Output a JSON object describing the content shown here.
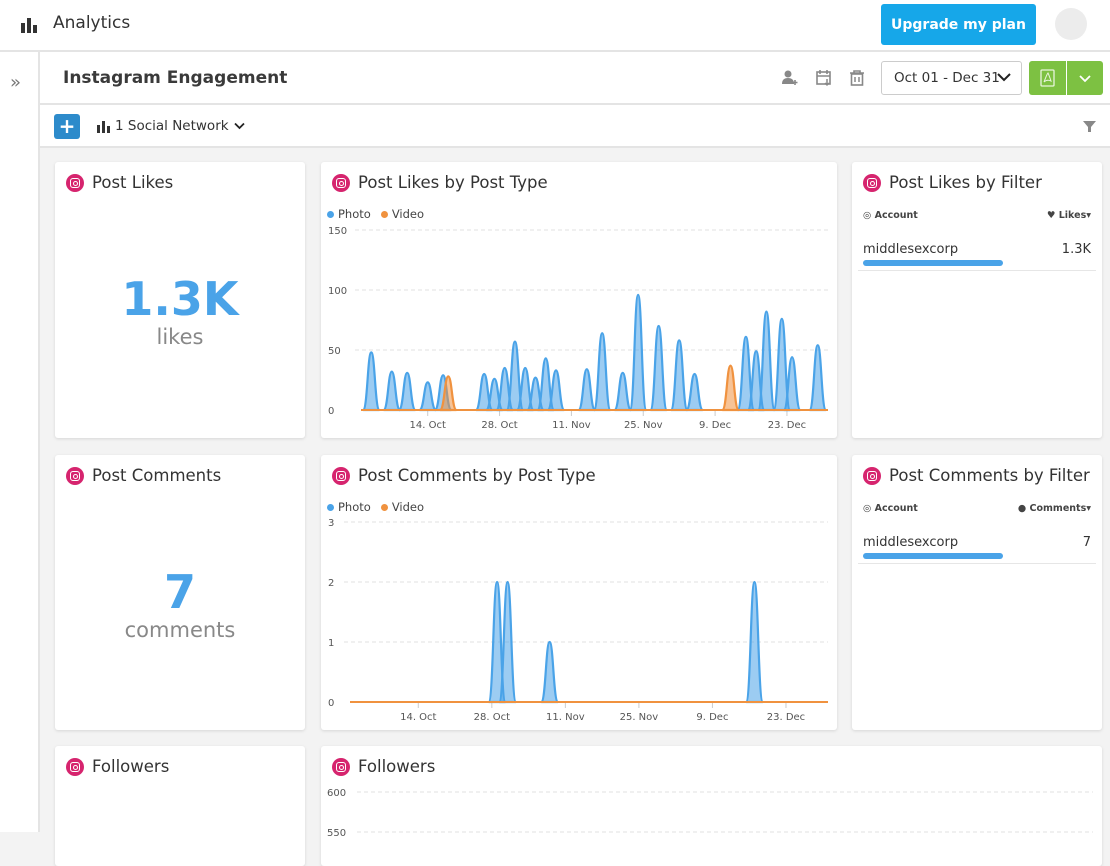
{
  "app": {
    "title": "Analytics",
    "upgrade_label": "Upgrade my plan"
  },
  "report": {
    "title": "Instagram Engagement",
    "date_range": "Oct 01 - Dec 31",
    "social_network_filter": "1 Social Network"
  },
  "colors": {
    "accent": "#16a7e9",
    "photo": "#4aa3e8",
    "video": "#f0923f",
    "export": "#7dc142",
    "instagram": "#d6246e"
  },
  "cards": {
    "post_likes": {
      "title": "Post Likes",
      "value": "1.3K",
      "unit": "likes"
    },
    "post_comments": {
      "title": "Post Comments",
      "value": "7",
      "unit": "comments"
    },
    "followers": {
      "title": "Followers"
    },
    "likes_by_type": {
      "title": "Post Likes by Post Type"
    },
    "comments_by_type": {
      "title": "Post Comments by Post Type"
    },
    "followers_chart": {
      "title": "Followers"
    },
    "likes_by_filter": {
      "title": "Post Likes by Filter",
      "col_account": "Account",
      "col_metric": "Likes▾",
      "rows": [
        {
          "account": "middlesexcorp",
          "value": "1.3K",
          "share": 1.0
        }
      ]
    },
    "comments_by_filter": {
      "title": "Post Comments by Filter",
      "col_account": "Account",
      "col_metric": "Comments▾",
      "rows": [
        {
          "account": "middlesexcorp",
          "value": "7",
          "share": 1.0
        }
      ]
    }
  },
  "chart_data": [
    {
      "type": "area",
      "title": "Post Likes by Post Type",
      "xlabel": "",
      "ylabel": "",
      "x_range": [
        "Oct 1",
        "Dec 31"
      ],
      "x_ticks": [
        "14. Oct",
        "28. Oct",
        "11. Nov",
        "25. Nov",
        "9. Dec",
        "23. Dec"
      ],
      "x_tick_days": [
        13,
        27,
        41,
        55,
        69,
        83
      ],
      "y_ticks": [
        0,
        50,
        100,
        150
      ],
      "ylim": [
        0,
        150
      ],
      "grid": true,
      "legend": "top-left",
      "days": 92,
      "series": [
        {
          "name": "Photo",
          "color": "#4aa3e8",
          "points": [
            {
              "day": 2,
              "value": 48
            },
            {
              "day": 6,
              "value": 32
            },
            {
              "day": 9,
              "value": 31
            },
            {
              "day": 13,
              "value": 23
            },
            {
              "day": 16,
              "value": 29
            },
            {
              "day": 24,
              "value": 30
            },
            {
              "day": 26,
              "value": 26
            },
            {
              "day": 28,
              "value": 35
            },
            {
              "day": 30,
              "value": 57
            },
            {
              "day": 32,
              "value": 35
            },
            {
              "day": 34,
              "value": 27
            },
            {
              "day": 36,
              "value": 43
            },
            {
              "day": 38,
              "value": 33
            },
            {
              "day": 44,
              "value": 34
            },
            {
              "day": 47,
              "value": 64
            },
            {
              "day": 51,
              "value": 31
            },
            {
              "day": 54,
              "value": 96
            },
            {
              "day": 58,
              "value": 70
            },
            {
              "day": 62,
              "value": 58
            },
            {
              "day": 65,
              "value": 30
            },
            {
              "day": 75,
              "value": 61
            },
            {
              "day": 77,
              "value": 49
            },
            {
              "day": 79,
              "value": 82
            },
            {
              "day": 82,
              "value": 76
            },
            {
              "day": 84,
              "value": 44
            },
            {
              "day": 89,
              "value": 54
            }
          ]
        },
        {
          "name": "Video",
          "color": "#f0923f",
          "points": [
            {
              "day": 17,
              "value": 28
            },
            {
              "day": 72,
              "value": 37
            }
          ]
        }
      ]
    },
    {
      "type": "area",
      "title": "Post Comments by Post Type",
      "xlabel": "",
      "ylabel": "",
      "x_range": [
        "Oct 1",
        "Dec 31"
      ],
      "x_ticks": [
        "14. Oct",
        "28. Oct",
        "11. Nov",
        "25. Nov",
        "9. Dec",
        "23. Dec"
      ],
      "x_tick_days": [
        13,
        27,
        41,
        55,
        69,
        83
      ],
      "y_ticks": [
        0,
        1,
        2,
        3
      ],
      "ylim": [
        0,
        3
      ],
      "grid": true,
      "legend": "top-left",
      "days": 92,
      "series": [
        {
          "name": "Photo",
          "color": "#4aa3e8",
          "points": [
            {
              "day": 28,
              "value": 2
            },
            {
              "day": 30,
              "value": 2
            },
            {
              "day": 38,
              "value": 1
            },
            {
              "day": 77,
              "value": 2
            }
          ]
        },
        {
          "name": "Video",
          "color": "#f0923f",
          "points": []
        }
      ]
    },
    {
      "type": "line",
      "title": "Followers",
      "y_ticks": [
        550,
        600
      ],
      "grid": true,
      "series": []
    }
  ]
}
